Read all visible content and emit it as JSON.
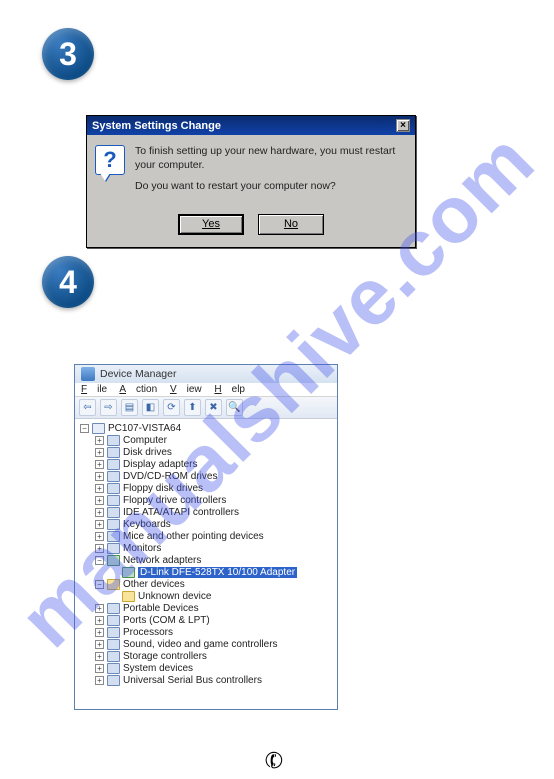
{
  "watermark": "manualshive.com",
  "steps": {
    "three": "3",
    "four": "4"
  },
  "dialog": {
    "title": "System Settings Change",
    "line1": "To finish setting up your new hardware, you must restart your computer.",
    "line2": "Do you want to restart your computer now?",
    "yes": "Yes",
    "no": "No"
  },
  "devmgr": {
    "title": "Device Manager",
    "menu": {
      "file": "File",
      "action": "Action",
      "view": "View",
      "help": "Help"
    },
    "root": "PC107-VISTA64",
    "items": [
      "Computer",
      "Disk drives",
      "Display adapters",
      "DVD/CD-ROM drives",
      "Floppy disk drives",
      "Floppy drive controllers",
      "IDE ATA/ATAPI controllers",
      "Keyboards",
      "Mice and other pointing devices",
      "Monitors"
    ],
    "network_adapters": "Network adapters",
    "selected_adapter": "D-Link DFE-528TX 10/100 Adapter",
    "other_devices": "Other devices",
    "unknown_device": "Unknown device",
    "items2": [
      "Portable Devices",
      "Ports (COM & LPT)",
      "Processors",
      "Sound, video and game controllers",
      "Storage controllers",
      "System devices",
      "Universal Serial Bus controllers"
    ]
  }
}
